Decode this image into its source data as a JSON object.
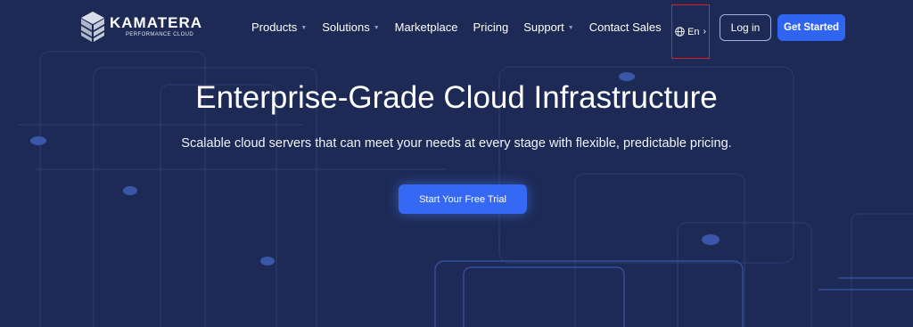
{
  "brand": {
    "name": "KAMATERA",
    "tagline": "PERFORMANCE CLOUD"
  },
  "nav": {
    "items": [
      {
        "label": "Products",
        "has_dropdown": true
      },
      {
        "label": "Solutions",
        "has_dropdown": true
      },
      {
        "label": "Marketplace",
        "has_dropdown": false
      },
      {
        "label": "Pricing",
        "has_dropdown": false
      },
      {
        "label": "Support",
        "has_dropdown": true
      },
      {
        "label": "Contact Sales",
        "has_dropdown": false
      }
    ],
    "caret_icon": "chevron-down-icon"
  },
  "language": {
    "label": "En",
    "icon": "globe-icon",
    "chevron_icon": "chevron-right-icon"
  },
  "actions": {
    "login_label": "Log in",
    "get_started_label": "Get Started"
  },
  "hero": {
    "title": "Enterprise-Grade Cloud Infrastructure",
    "subtitle": "Scalable cloud servers that can meet your needs at every stage with flexible, predictable pricing.",
    "cta_label": "Start Your Free Trial"
  },
  "colors": {
    "background": "#1c2a55",
    "accent": "#3065f2",
    "highlight_box": "#e02020"
  }
}
